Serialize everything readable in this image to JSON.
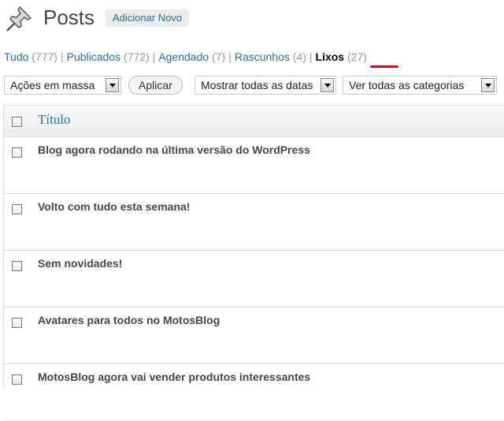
{
  "header": {
    "icon": "pushpin-icon",
    "title": "Posts",
    "add_new_label": "Adicionar Novo"
  },
  "filters": [
    {
      "label": "Tudo",
      "count": "(777)"
    },
    {
      "label": "Publicados",
      "count": "(772)"
    },
    {
      "label": "Agendado",
      "count": "(7)"
    },
    {
      "label": "Rascunhos",
      "count": "(4)"
    },
    {
      "label": "Lixos",
      "count": "(27)"
    }
  ],
  "separator": "|",
  "highlight_color": "#e8001c",
  "toolbar": {
    "bulk_actions": "Ações em massa",
    "apply_label": "Aplicar",
    "dates_filter": "Mostrar todas as datas",
    "categories_filter": "Ver todas as categorias"
  },
  "table": {
    "column_title": "Título",
    "rows": [
      {
        "title": "Blog agora rodando na última versão do WordPress"
      },
      {
        "title": "Volto com tudo esta semana!"
      },
      {
        "title": "Sem novidades!"
      },
      {
        "title": "Avatares para todos no MotosBlog"
      },
      {
        "title": "MotosBlog agora vai vender produtos interessantes"
      }
    ]
  },
  "colors": {
    "link": "#21759b",
    "title_text": "#464646"
  }
}
